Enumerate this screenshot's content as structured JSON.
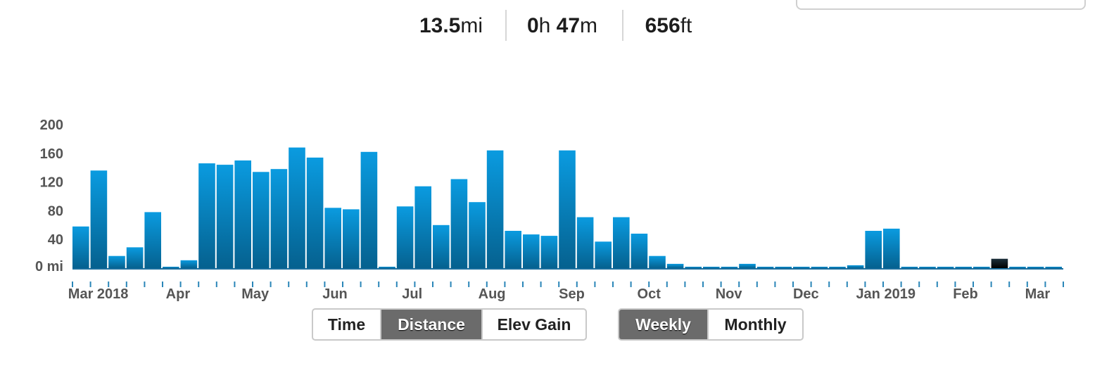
{
  "stats": {
    "distance": {
      "value": "13.5",
      "unit": "mi"
    },
    "time": {
      "h_value": "0",
      "h_unit": "h",
      "m_value": "47",
      "m_unit": "m"
    },
    "elevation": {
      "value": "656",
      "unit": "ft"
    }
  },
  "chart_data": {
    "type": "bar",
    "ylabel": "",
    "xlabel": "",
    "ylim": [
      0,
      200
    ],
    "yticks": [
      "0 mi",
      "40",
      "80",
      "120",
      "160",
      "200"
    ],
    "grid": false,
    "x_start_week": "2018-02-19",
    "values": [
      58,
      136,
      17,
      29,
      78,
      0,
      11,
      146,
      144,
      150,
      134,
      138,
      168,
      154,
      84,
      82,
      162,
      2,
      86,
      114,
      60,
      124,
      92,
      164,
      52,
      47,
      45,
      164,
      71,
      37,
      71,
      48,
      17,
      6,
      0,
      0,
      0,
      6,
      0,
      0,
      0,
      0,
      0,
      4,
      52,
      55,
      0,
      0,
      0,
      0,
      0,
      13,
      0,
      0,
      0
    ],
    "highlight_index": 51,
    "month_labels": [
      {
        "label": "Mar 2018",
        "date": "2018-03-01"
      },
      {
        "label": "Apr",
        "date": "2018-04-01"
      },
      {
        "label": "May",
        "date": "2018-05-01"
      },
      {
        "label": "Jun",
        "date": "2018-06-01"
      },
      {
        "label": "Jul",
        "date": "2018-07-01"
      },
      {
        "label": "Aug",
        "date": "2018-08-01"
      },
      {
        "label": "Sep",
        "date": "2018-09-01"
      },
      {
        "label": "Oct",
        "date": "2018-10-01"
      },
      {
        "label": "Nov",
        "date": "2018-11-01"
      },
      {
        "label": "Dec",
        "date": "2018-12-01"
      },
      {
        "label": "Jan 2019",
        "date": "2019-01-01"
      },
      {
        "label": "Feb",
        "date": "2019-02-01"
      },
      {
        "label": "Mar",
        "date": "2019-03-01"
      }
    ],
    "colors": {
      "bar_top": "#0a9be0",
      "bar_bottom": "#05618f",
      "highlight_top": "#1c2f3a",
      "highlight_bottom": "#000000",
      "baseline": "#1a6e9e",
      "tick": "#2a86b8",
      "label": "#555555"
    }
  },
  "metric_buttons": [
    {
      "label": "Time",
      "active": false
    },
    {
      "label": "Distance",
      "active": true
    },
    {
      "label": "Elev Gain",
      "active": false
    }
  ],
  "period_buttons": [
    {
      "label": "Weekly",
      "active": true
    },
    {
      "label": "Monthly",
      "active": false
    }
  ]
}
